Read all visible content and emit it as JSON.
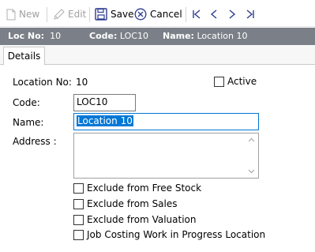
{
  "toolbar": {
    "new_label": "New",
    "edit_label": "Edit",
    "save_label": "Save",
    "cancel_label": "Cancel"
  },
  "header": {
    "loc_no_label": "Loc No:",
    "loc_no_value": "10",
    "code_label": "Code:",
    "code_value": "LOC10",
    "name_label": "Name:",
    "name_value": "Location 10"
  },
  "tabs": [
    {
      "label": "Details"
    }
  ],
  "form": {
    "location_no_label": "Location No:",
    "location_no_value": "10",
    "active_label": "Active",
    "code_label": "Code:",
    "code_value": "LOC10",
    "name_label": "Name:",
    "name_value": "Location 10",
    "address_label": "Address :",
    "address_value": "",
    "checkboxes": [
      {
        "label": "Exclude from Free Stock",
        "checked": false
      },
      {
        "label": "Exclude from Sales",
        "checked": false
      },
      {
        "label": "Exclude from Valuation",
        "checked": false
      },
      {
        "label": "Job Costing Work in Progress Location",
        "checked": false
      }
    ]
  },
  "colors": {
    "header_bar": "#7b8088",
    "focus_border": "#0078d7",
    "selection": "#0078d7",
    "icon_blue": "#2b3a8f"
  }
}
